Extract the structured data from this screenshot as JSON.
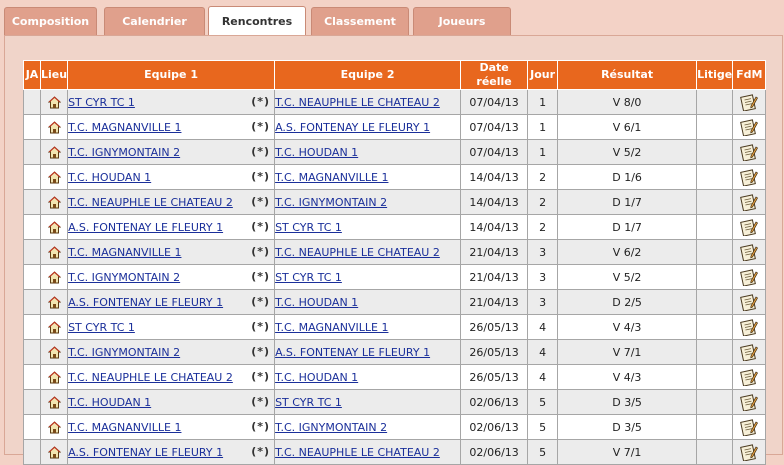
{
  "tabs": [
    {
      "label": "Composition",
      "active": false
    },
    {
      "label": "Calendrier",
      "active": false
    },
    {
      "label": "Rencontres",
      "active": true
    },
    {
      "label": "Classement",
      "active": false
    },
    {
      "label": "Joueurs",
      "active": false
    }
  ],
  "table": {
    "headers": {
      "ja": "JA",
      "lieu": "Lieu",
      "equipe1": "Equipe 1",
      "equipe2": "Equipe 2",
      "date": "Date réelle",
      "jour": "Jour",
      "resultat": "Résultat",
      "litige": "Litige",
      "fdm": "FdM"
    },
    "star_marker": "(*)",
    "rows": [
      {
        "team1": "ST CYR TC 1",
        "team2": "T.C. NEAUPHLE LE CHATEAU 2",
        "date": "07/04/13",
        "jour": "1",
        "result": "V 8/0"
      },
      {
        "team1": "T.C. MAGNANVILLE 1",
        "team2": "A.S. FONTENAY LE FLEURY 1",
        "date": "07/04/13",
        "jour": "1",
        "result": "V 6/1"
      },
      {
        "team1": "T.C. IGNYMONTAIN 2",
        "team2": "T.C. HOUDAN 1",
        "date": "07/04/13",
        "jour": "1",
        "result": "V 5/2"
      },
      {
        "team1": "T.C. HOUDAN 1",
        "team2": "T.C. MAGNANVILLE 1",
        "date": "14/04/13",
        "jour": "2",
        "result": "D 1/6"
      },
      {
        "team1": "T.C. NEAUPHLE LE CHATEAU 2",
        "team2": "T.C. IGNYMONTAIN 2",
        "date": "14/04/13",
        "jour": "2",
        "result": "D 1/7"
      },
      {
        "team1": "A.S. FONTENAY LE FLEURY 1",
        "team2": "ST CYR TC 1",
        "date": "14/04/13",
        "jour": "2",
        "result": "D 1/7"
      },
      {
        "team1": "T.C. MAGNANVILLE 1",
        "team2": "T.C. NEAUPHLE LE CHATEAU 2",
        "date": "21/04/13",
        "jour": "3",
        "result": "V 6/2"
      },
      {
        "team1": "T.C. IGNYMONTAIN 2",
        "team2": "ST CYR TC 1",
        "date": "21/04/13",
        "jour": "3",
        "result": "V 5/2"
      },
      {
        "team1": "A.S. FONTENAY LE FLEURY 1",
        "team2": "T.C. HOUDAN 1",
        "date": "21/04/13",
        "jour": "3",
        "result": "D 2/5"
      },
      {
        "team1": "ST CYR TC 1",
        "team2": "T.C. MAGNANVILLE 1",
        "date": "26/05/13",
        "jour": "4",
        "result": "V 4/3"
      },
      {
        "team1": "T.C. IGNYMONTAIN 2",
        "team2": "A.S. FONTENAY LE FLEURY 1",
        "date": "26/05/13",
        "jour": "4",
        "result": "V 7/1"
      },
      {
        "team1": "T.C. NEAUPHLE LE CHATEAU 2",
        "team2": "T.C. HOUDAN 1",
        "date": "26/05/13",
        "jour": "4",
        "result": "V 4/3"
      },
      {
        "team1": "T.C. HOUDAN 1",
        "team2": "ST CYR TC 1",
        "date": "02/06/13",
        "jour": "5",
        "result": "D 3/5"
      },
      {
        "team1": "T.C. MAGNANVILLE 1",
        "team2": "T.C. IGNYMONTAIN 2",
        "date": "02/06/13",
        "jour": "5",
        "result": "D 3/5"
      },
      {
        "team1": "A.S. FONTENAY LE FLEURY 1",
        "team2": "T.C. NEAUPHLE LE CHATEAU 2",
        "date": "02/06/13",
        "jour": "5",
        "result": "V 7/1"
      }
    ]
  },
  "icons": {
    "lieu": "house-icon",
    "fdm": "match-sheet-icon"
  },
  "colors": {
    "header_bg": "#e8671e",
    "tab_bg": "#e0a08c",
    "link": "#1a2f9a",
    "row_alt": "#ececec"
  }
}
